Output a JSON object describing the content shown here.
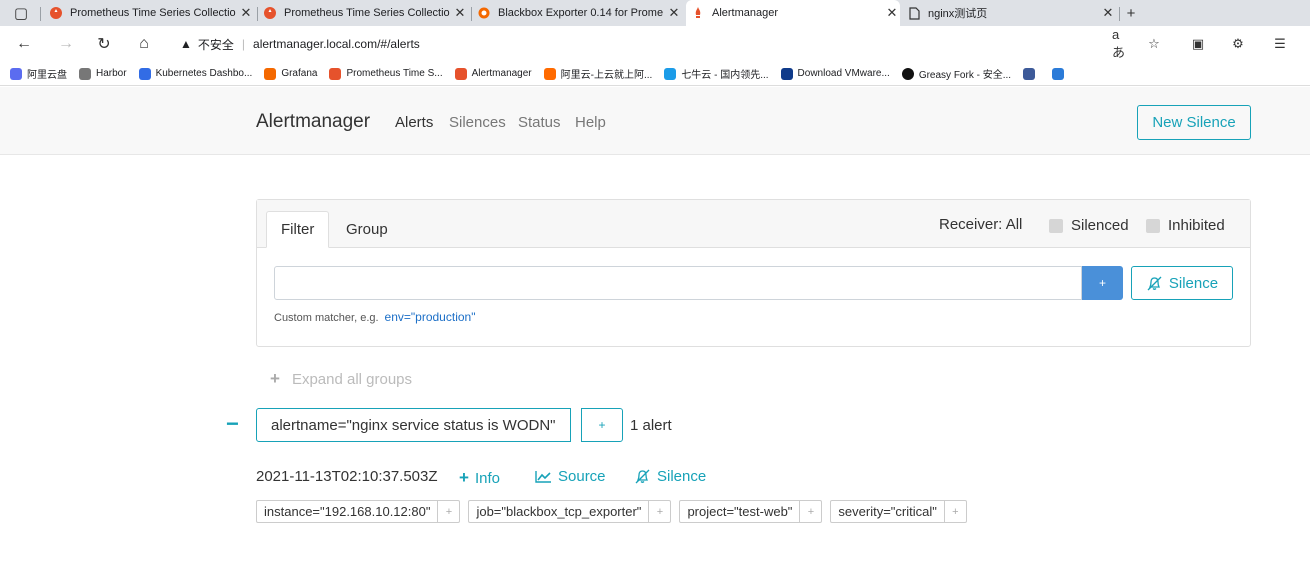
{
  "browser": {
    "tabs": [
      {
        "title": "Prometheus Time Series Collectio",
        "favicon": "prometheus-icon"
      },
      {
        "title": "Prometheus Time Series Collectio",
        "favicon": "prometheus-icon"
      },
      {
        "title": "Blackbox Exporter 0.14 for Prome",
        "favicon": "grafana-icon"
      },
      {
        "title": "Alertmanager",
        "favicon": "prometheus-icon",
        "active": true
      },
      {
        "title": "nginx测试页",
        "favicon": "page-icon"
      }
    ],
    "address": {
      "security_text": "不安全",
      "url": "alertmanager.local.com/#/alerts"
    },
    "bookmarks": [
      {
        "label": "阿里云盘",
        "color": "#5b6cf0"
      },
      {
        "label": "Harbor",
        "color": "#777777"
      },
      {
        "label": "Kubernetes Dashbo...",
        "color": "#326ce5"
      },
      {
        "label": "Grafana",
        "color": "#f46800"
      },
      {
        "label": "Prometheus Time S...",
        "color": "#e6522c"
      },
      {
        "label": "Alertmanager",
        "color": "#e6522c"
      },
      {
        "label": "阿里云-上云就上阿...",
        "color": "#ff6a00"
      },
      {
        "label": "七牛云 - 国内领先...",
        "color": "#1c9ce8"
      },
      {
        "label": "Download VMware...",
        "color": "#0f3a8a"
      },
      {
        "label": "Greasy Fork - 安全...",
        "color": "#111111"
      }
    ]
  },
  "app": {
    "brand": "Alertmanager",
    "nav": [
      "Alerts",
      "Silences",
      "Status",
      "Help"
    ],
    "new_silence": "New Silence"
  },
  "filter": {
    "tabs": [
      "Filter",
      "Group"
    ],
    "receiver": "Receiver: All",
    "silenced": "Silenced",
    "inhibited": "Inhibited",
    "input_value": "",
    "add_label": "+",
    "silence_label": "Silence",
    "hint": "Custom matcher, e.g.",
    "hint_example": "env=\"production\""
  },
  "expand_all": "Expand all groups",
  "group": {
    "label": "alertname=\"nginx service status is WODN\"",
    "plus": "+",
    "count": "1 alert",
    "alert": {
      "timestamp": "2021-11-13T02:10:37.503Z",
      "actions": [
        "Info",
        "Source",
        "Silence"
      ],
      "labels": [
        "instance=\"192.168.10.12:80\"",
        "job=\"blackbox_tcp_exporter\"",
        "project=\"test-web\"",
        "severity=\"critical\""
      ]
    }
  },
  "colors": {
    "accent": "#17a2b8",
    "primary_button": "#4a90d9",
    "link": "#1c6fc7"
  }
}
